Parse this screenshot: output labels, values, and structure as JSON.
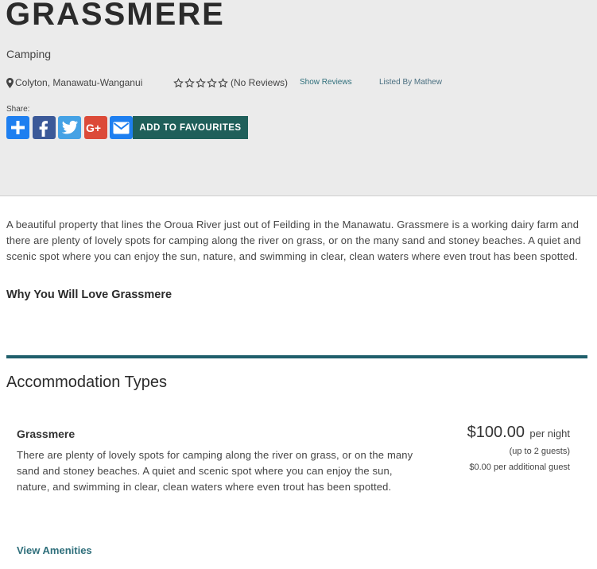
{
  "listing": {
    "title": "GRASSMERE",
    "category": "Camping",
    "location": "Colyton, Manawatu-Wanganui",
    "rating": {
      "stars": 0,
      "max": 5,
      "text": "(No Reviews)"
    },
    "show_reviews": "Show Reviews",
    "listed_by": "Listed By Mathew"
  },
  "share": {
    "label": "Share:",
    "buttons": [
      {
        "icon": "plus-icon",
        "color": "#1e7ff0"
      },
      {
        "icon": "facebook-icon",
        "color": "#3b5998"
      },
      {
        "icon": "twitter-icon",
        "color": "#45a2e5"
      },
      {
        "icon": "google-plus-icon",
        "color": "#dc4a38"
      },
      {
        "icon": "email-icon",
        "color": "#1e7ff0"
      }
    ],
    "favourites_label": "ADD TO FAVOURITES"
  },
  "description": "A beautiful property that lines the Oroua River just out of Feilding in the Manawatu. Grassmere is a working dairy farm and there are plenty of lovely spots for camping along the river on grass, or on the many sand and stoney beaches. A quiet and scenic spot where you can enjoy the sun, nature, and swimming in clear, clean waters where even trout has been spotted.",
  "why_heading": "Why You Will Love Grassmere",
  "accommodation": {
    "heading": "Accommodation Types",
    "items": [
      {
        "name": "Grassmere",
        "description": "There are plenty of lovely spots for camping along the river on grass, or on the many sand and stoney beaches. A quiet and scenic spot where you can enjoy the sun, nature, and swimming in clear, clean waters where even trout has been spotted.",
        "price": "$100.00",
        "price_unit": "per night",
        "guests": "(up to 2 guests)",
        "extra_guest": "$0.00 per additional guest",
        "view_amenities": "View Amenities"
      }
    ]
  },
  "colors": {
    "accent": "#1f5f5a",
    "rule": "#1f5f6b",
    "link": "#2f6f7b"
  }
}
